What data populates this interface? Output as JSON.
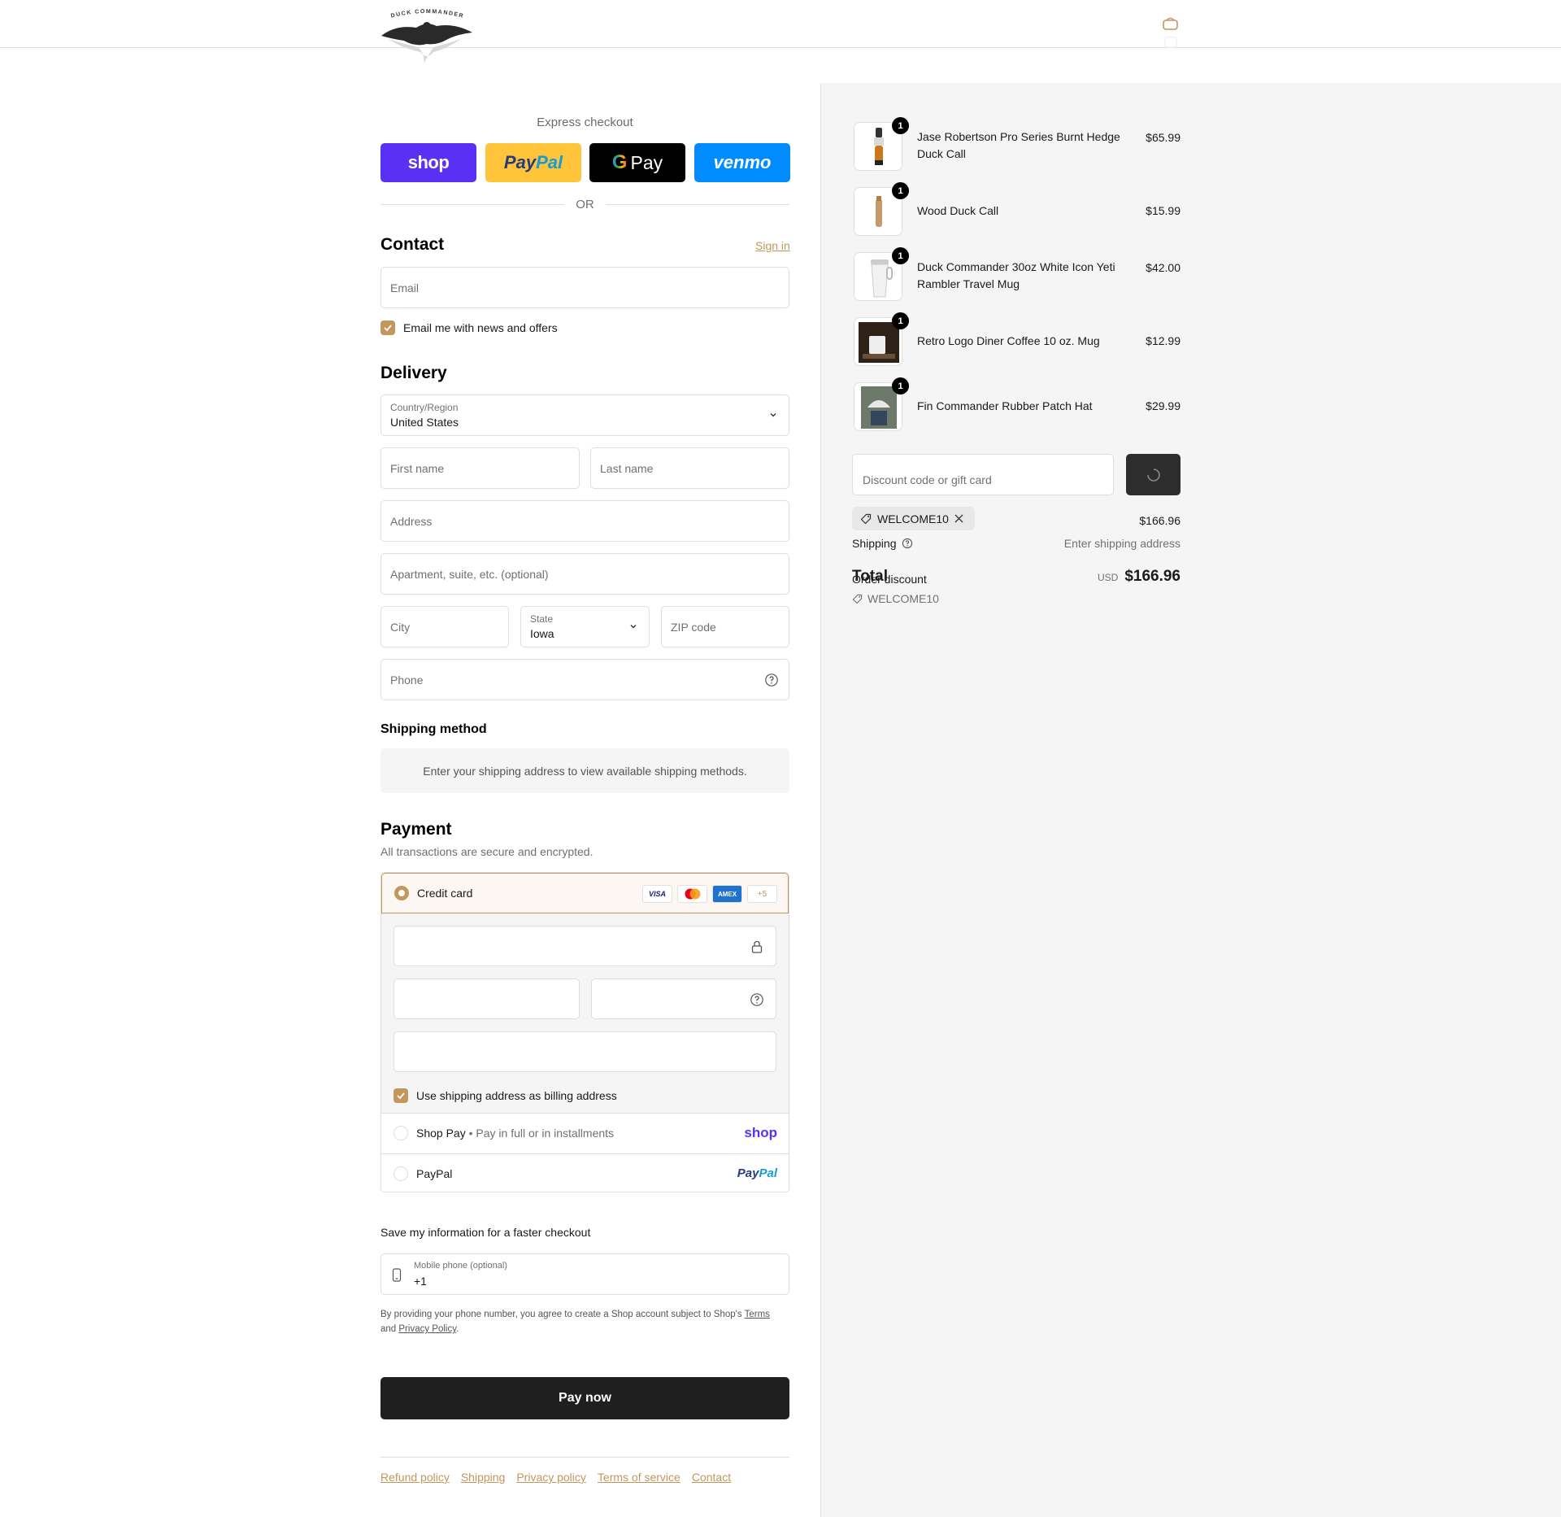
{
  "header": {
    "logo_text": "DUCK COMMANDER",
    "cart_icon": "bag-icon"
  },
  "express": {
    "title": "Express checkout",
    "shop_label": "shop",
    "paypal_label_1": "Pay",
    "paypal_label_2": "Pal",
    "gpay_label_g": "G",
    "gpay_label": "Pay",
    "venmo_label": "venmo",
    "or_label": "OR"
  },
  "contact": {
    "title": "Contact",
    "sign_in": "Sign in",
    "email_placeholder": "Email",
    "news_label": "Email me with news and offers"
  },
  "delivery": {
    "title": "Delivery",
    "country_label": "Country/Region",
    "country_value": "United States",
    "first_name": "First name",
    "last_name": "Last name",
    "address": "Address",
    "apartment": "Apartment, suite, etc. (optional)",
    "city": "City",
    "state_label": "State",
    "state_value": "Iowa",
    "zip": "ZIP code",
    "phone": "Phone"
  },
  "shipping_method": {
    "title": "Shipping method",
    "message": "Enter your shipping address to view available shipping methods."
  },
  "payment": {
    "title": "Payment",
    "subtitle": "All transactions are secure and encrypted.",
    "credit_card_label": "Credit card",
    "card_logos": [
      "VISA",
      "MC",
      "AMEX",
      "+5"
    ],
    "billing_label": "Use shipping address as billing address",
    "shop_pay_label": "Shop Pay",
    "shop_pay_sep": "•",
    "shop_pay_note": "Pay in full or in installments",
    "shop_pay_logo": "shop",
    "paypal_label": "PayPal",
    "paypal_logo_1": "Pay",
    "paypal_logo_2": "Pal"
  },
  "save_info": {
    "title": "Save my information for a faster checkout",
    "phone_label": "Mobile phone (optional)",
    "phone_value": "+1",
    "disclaimer_1": "By providing your phone number, you agree to create a Shop account subject to Shop's",
    "terms": "Terms",
    "disclaimer_2": "and",
    "privacy": "Privacy Policy",
    "disclaimer_3": "."
  },
  "pay_now": "Pay now",
  "footer": {
    "links": [
      "Refund policy",
      "Shipping",
      "Privacy policy",
      "Terms of service",
      "Contact"
    ]
  },
  "cart": {
    "items": [
      {
        "name": "Jase Robertson Pro Series Burnt Hedge Duck Call",
        "price": "$65.99",
        "qty": "1"
      },
      {
        "name": "Wood Duck Call",
        "price": "$15.99",
        "qty": "1"
      },
      {
        "name": "Duck Commander 30oz White Icon Yeti Rambler Travel Mug",
        "price": "$42.00",
        "qty": "1"
      },
      {
        "name": "Retro Logo Diner Coffee 10 oz. Mug",
        "price": "$12.99",
        "qty": "1"
      },
      {
        "name": "Fin Commander Rubber Patch Hat",
        "price": "$29.99",
        "qty": "1"
      }
    ],
    "discount_placeholder": "Discount code or gift card",
    "applied_code": "WELCOME10",
    "subtotal_value": "$166.96",
    "shipping_label": "Shipping",
    "shipping_value": "Enter shipping address",
    "order_discount_label": "Order discount",
    "order_discount_code": "WELCOME10",
    "total_label": "Total",
    "currency": "USD",
    "total_value": "$166.96"
  },
  "colors": {
    "accent": "#c1975d",
    "shop_purple": "#5a31f4",
    "paypal_yellow": "#ffc439",
    "venmo_blue": "#008cff",
    "dark_button": "#1f1f1f"
  }
}
